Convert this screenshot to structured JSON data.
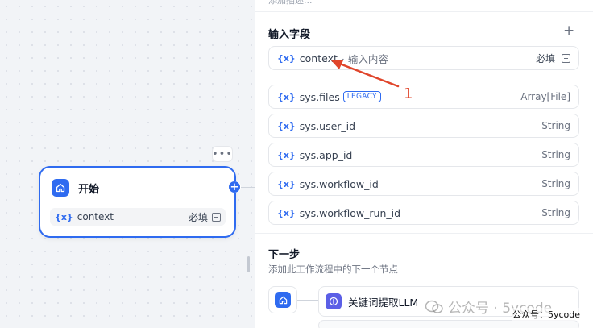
{
  "canvas": {
    "node": {
      "title": "开始",
      "more_label": "•••",
      "variable": {
        "icon_text": "{x}",
        "name": "context",
        "required": "必填"
      },
      "add_label": "+"
    }
  },
  "panel": {
    "top_text": "添加描述...",
    "input_fields": {
      "title": "输入字段",
      "add_label": "+",
      "items": [
        {
          "icon_text": "{x}",
          "name": "context",
          "desc": "· 输入内容",
          "required": "必填",
          "type": ""
        },
        {
          "icon_text": "{x}",
          "name": "sys.files",
          "badge": "LEGACY",
          "type": "Array[File]"
        },
        {
          "icon_text": "{x}",
          "name": "sys.user_id",
          "type": "String"
        },
        {
          "icon_text": "{x}",
          "name": "sys.app_id",
          "type": "String"
        },
        {
          "icon_text": "{x}",
          "name": "sys.workflow_id",
          "type": "String"
        },
        {
          "icon_text": "{x}",
          "name": "sys.workflow_run_id",
          "type": "String"
        }
      ]
    },
    "next_step": {
      "title": "下一步",
      "description": "添加此工作流程中的下一个节点",
      "block_label": "关键词提取LLM"
    }
  },
  "annotation": {
    "number": "1",
    "color": "#e0452b"
  },
  "watermark": {
    "big_text": "公众号 · 5ycode",
    "small_text": "公众号：5ycode"
  },
  "colors": {
    "accent": "#2f6bf0",
    "llm": "#5b5fe6"
  }
}
